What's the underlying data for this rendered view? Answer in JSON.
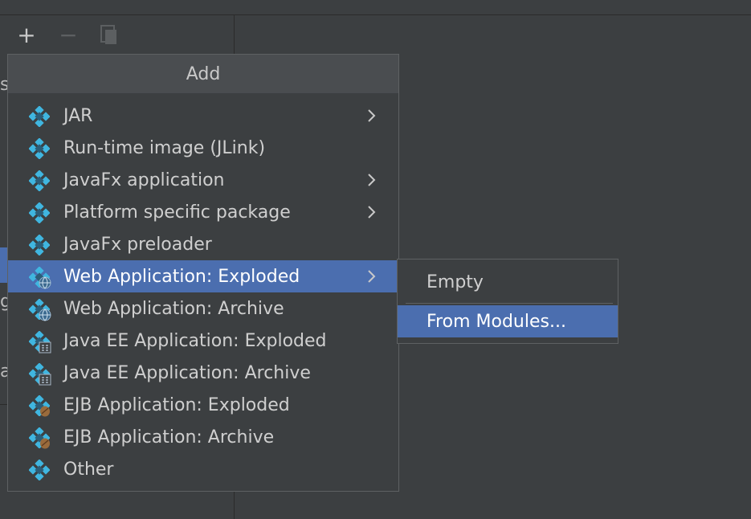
{
  "toolbar": {
    "add_icon": "plus-icon",
    "remove_icon": "minus-icon",
    "copy_icon": "copy-icon",
    "add_glyph": "+",
    "remove_glyph": "−"
  },
  "side_fragments": [
    "s",
    "g",
    "a"
  ],
  "popup": {
    "title": "Add",
    "items": [
      {
        "label": "JAR",
        "icon": "artifact-icon",
        "submenu": true
      },
      {
        "label": "Run-time image (JLink)",
        "icon": "artifact-icon",
        "submenu": false
      },
      {
        "label": "JavaFx application",
        "icon": "artifact-icon",
        "submenu": true
      },
      {
        "label": "Platform specific package",
        "icon": "artifact-icon",
        "submenu": true
      },
      {
        "label": "JavaFx preloader",
        "icon": "artifact-icon",
        "submenu": false
      },
      {
        "label": "Web Application: Exploded",
        "icon": "web-artifact-icon",
        "submenu": true,
        "selected": true
      },
      {
        "label": "Web Application: Archive",
        "icon": "web-artifact-icon",
        "submenu": false
      },
      {
        "label": "Java EE Application: Exploded",
        "icon": "javaee-artifact-icon",
        "submenu": false
      },
      {
        "label": "Java EE Application: Archive",
        "icon": "javaee-artifact-icon",
        "submenu": false
      },
      {
        "label": "EJB Application: Exploded",
        "icon": "ejb-artifact-icon",
        "submenu": false
      },
      {
        "label": "EJB Application: Archive",
        "icon": "ejb-artifact-icon",
        "submenu": false
      },
      {
        "label": "Other",
        "icon": "artifact-icon",
        "submenu": false
      }
    ]
  },
  "submenu": {
    "items": [
      {
        "label": "Empty"
      },
      {
        "label": "From Modules...",
        "selected": true
      }
    ]
  },
  "colors": {
    "background": "#3c3f41",
    "selection": "#4b6eaf",
    "icon_blue": "#40b6e0",
    "icon_dark": "#2c5d77",
    "ejb_brown": "#9a6b3c"
  }
}
